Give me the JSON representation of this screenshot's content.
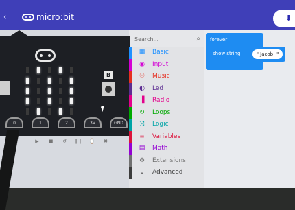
{
  "header": {
    "back_glyph": "‹",
    "logo_text": "micro:bit",
    "action_icon": "download-icon",
    "action_glyph": "⬇"
  },
  "simulator": {
    "button_b_label": "B",
    "pins": [
      "0",
      "1",
      "2",
      "3V",
      "GND"
    ],
    "control_icons": [
      "▶",
      "■",
      "↺",
      "❙❙",
      "⌚",
      "✖"
    ],
    "led_rows": [
      [
        0,
        1,
        0,
        1,
        0
      ],
      [
        1,
        0,
        1,
        0,
        1
      ],
      [
        1,
        0,
        1,
        0,
        1
      ],
      [
        1,
        0,
        1,
        0,
        1
      ],
      [
        0,
        1,
        0,
        1,
        0
      ]
    ]
  },
  "search": {
    "placeholder": "Search...",
    "icon": "search-icon",
    "glyph": "🔍"
  },
  "toolbox": {
    "categories": [
      {
        "label": "Basic",
        "color": "#1e90ff",
        "glyph": "▦"
      },
      {
        "label": "Input",
        "color": "#d400d4",
        "glyph": "◉"
      },
      {
        "label": "Music",
        "color": "#e63022",
        "glyph": "☉"
      },
      {
        "label": "Led",
        "color": "#5c2d91",
        "glyph": "◐"
      },
      {
        "label": "Radio",
        "color": "#e3008c",
        "glyph": "▐"
      },
      {
        "label": "Loops",
        "color": "#00aa00",
        "glyph": "↻"
      },
      {
        "label": "Logic",
        "color": "#00a4a6",
        "glyph": "⤨"
      },
      {
        "label": "Variables",
        "color": "#dc143c",
        "glyph": "≡"
      },
      {
        "label": "Math",
        "color": "#9400d3",
        "glyph": "▤"
      },
      {
        "label": "Extensions",
        "color": "#707070",
        "glyph": "⚙"
      },
      {
        "label": "Advanced",
        "color": "#3c3c3c",
        "glyph": "⌄"
      }
    ]
  },
  "workspace": {
    "forever_label": "forever",
    "show_string_label": "show string",
    "string_value": "\" Jacob! \""
  }
}
